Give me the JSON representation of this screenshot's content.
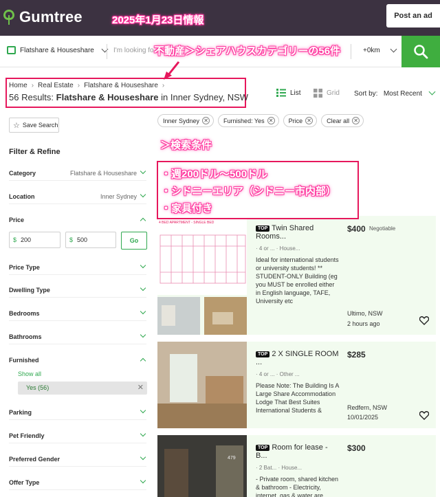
{
  "header": {
    "logo_text": "Gumtree",
    "post_ad_label": "Post an ad",
    "overlay_date": "2025年1月23日情報"
  },
  "search": {
    "category": "Flatshare & Houseshare",
    "keyword_placeholder": "I'm looking fo",
    "radius": "+0km",
    "overlay_category": "不動産＞シェアハウスカテゴリーの56件"
  },
  "breadcrumb": [
    "Home",
    "Real Estate",
    "Flatshare & Houseshare"
  ],
  "results": {
    "count_text": "56 Results:",
    "category_bold": "Flatshare & Houseshare",
    "location_text": "in Inner Sydney, NSW"
  },
  "view": {
    "list_label": "List",
    "grid_label": "Grid",
    "sort_label": "Sort by:",
    "sort_value": "Most Recent"
  },
  "sidebar": {
    "save_search": "Save Search",
    "filter_title": "Filter & Refine",
    "category_label": "Category",
    "category_value": "Flatshare & Houseshare",
    "location_label": "Location",
    "location_value": "Inner Sydney",
    "price_label": "Price",
    "price_min": "200",
    "price_max": "500",
    "go_label": "Go",
    "price_type": "Price Type",
    "dwelling_type": "Dwelling Type",
    "bedrooms": "Bedrooms",
    "bathrooms": "Bathrooms",
    "furnished": "Furnished",
    "show_all": "Show all",
    "furnished_chip": "Yes (56)",
    "parking": "Parking",
    "pet_friendly": "Pet Friendly",
    "preferred_gender": "Preferred Gender",
    "offer_type": "Offer Type"
  },
  "chips": [
    "Inner Sydney",
    "Furnished: Yes",
    "Price",
    "Clear all"
  ],
  "overlay": {
    "search_title": "＞検索条件",
    "cond1": "・週200ドル～500ドル",
    "cond2": "・シドニーエリア（シドニー市内部）",
    "cond3": "・家具付き"
  },
  "listings": [
    {
      "badge": "TOP",
      "title": "Twin Shared Rooms...",
      "meta": "· 4 or ...   · House...",
      "desc": "Ideal for international students or university students! ** STUDENT-ONLY Building (eg you MUST be enrolled either in English language, TAFE, University etc",
      "price": "$400",
      "negotiable": "Negotiable",
      "location": "Ultimo, NSW",
      "time": "2 hours ago",
      "photo_caption": "4 BED APARTMENT - SINGLE BED"
    },
    {
      "badge": "TOP",
      "title": "2 X SINGLE ROOM ...",
      "meta": "· 4 or ...   · Other ...",
      "desc": "Please Note: The Building Is A Large Share Accommodation Lodge That Best Suites International Students &",
      "price": "$285",
      "location": "Redfern, NSW",
      "time": "10/01/2025"
    },
    {
      "badge": "TOP",
      "title": "Room for lease - B...",
      "meta": "· 2 Bat...   · House...",
      "desc": "- Private room, shared kitchen & bathroom - Electricity, internet, gas & water are included in rent",
      "price": "$300"
    }
  ],
  "colors": {
    "header": "#3c3241",
    "accent": "#3fae3f",
    "highlight": "#e6175c",
    "listing_bg": "#f2fbef"
  }
}
